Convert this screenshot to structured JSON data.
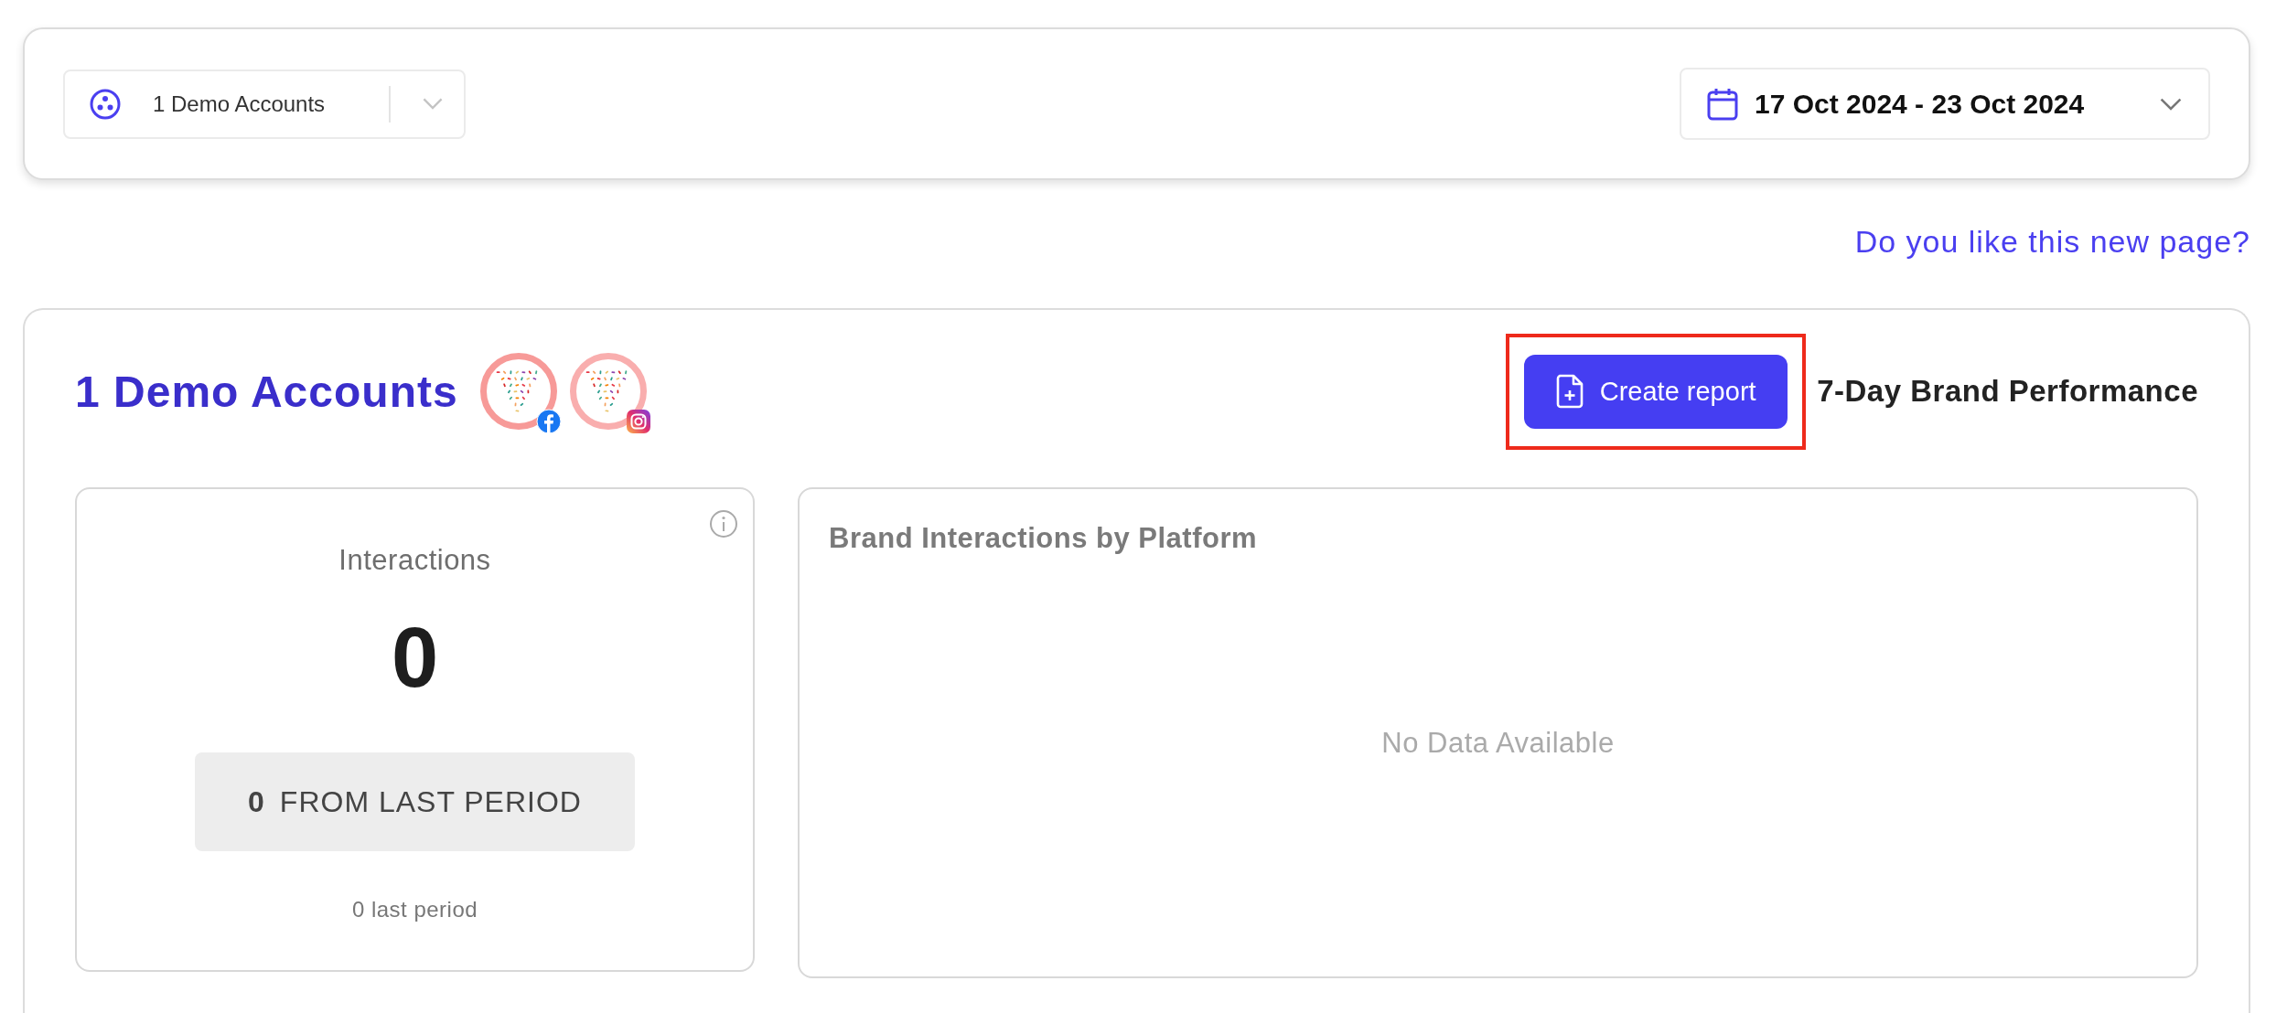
{
  "filter_bar": {
    "account_select": {
      "label": "1 Demo Accounts"
    },
    "date_range": {
      "label": "17 Oct 2024 - 23 Oct 2024"
    }
  },
  "feedback_link": "Do you like this new page?",
  "overview": {
    "title": "1 Demo Accounts",
    "accounts": [
      {
        "kind": "facebook"
      },
      {
        "kind": "instagram"
      }
    ],
    "create_report": {
      "label": "Create report",
      "highlighted": true
    },
    "period_title": "7-Day Brand Performance",
    "interactions_card": {
      "title": "Interactions",
      "value": "0",
      "change_value": "0",
      "change_label": "FROM LAST PERIOD",
      "previous": "0 last period"
    },
    "platform_card": {
      "title": "Brand Interactions by Platform",
      "empty_message": "No Data Available"
    }
  }
}
